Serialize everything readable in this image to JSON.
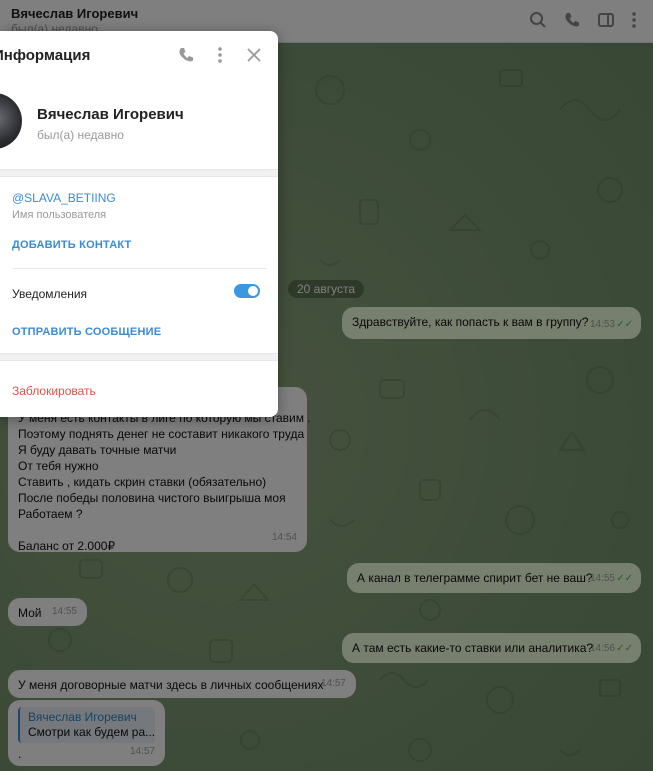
{
  "header": {
    "name": "Вячеслав Игоревич",
    "status": "был(а) недавно",
    "icons": [
      "search-icon",
      "phone-icon",
      "sidebar-icon",
      "more-icon"
    ]
  },
  "panel": {
    "title": "Информация",
    "name": "Вячеслав Игоревич",
    "status": "был(а) недавно",
    "username": "@SLAVA_BETIING",
    "username_label": "Имя пользователя",
    "add_contact": "ДОБАВИТЬ КОНТАКТ",
    "notifications_label": "Уведомления",
    "notifications_on": true,
    "send_message": "ОТПРАВИТЬ СООБЩЕНИЕ",
    "block": "Заблокировать"
  },
  "chat": {
    "date": "20 августа",
    "messages": [
      {
        "text": "Здравствуйте, как попасть к вам в группу?",
        "time": "14:53"
      },
      {
        "lines": [
          "У меня есть контакты в лиге по которую мы ставим .",
          "Поэтому поднять денег не составит никакого труда",
          "Я буду давать точные матчи",
          "От тебя нужно",
          "Ставить , кидать скрин ставки (обязательно)",
          "После победы половина чистого выигрыша моя",
          "Работаем ?",
          "",
          "Баланс от 2.000₽"
        ],
        "time": "14:54"
      },
      {
        "text": "А канал в телеграмме спирит бет не ваш?",
        "time": "14:55"
      },
      {
        "text": "Мой",
        "time": "14:55"
      },
      {
        "text": "А там есть какие-то ставки или аналитика?",
        "time": "14:56"
      },
      {
        "text": "У меня договорные матчи здесь в личных сообщениях",
        "time": "14:57"
      },
      {
        "reply_name": "Вячеслав Игоревич",
        "reply_text": "Смотри как будем ра...",
        "text": ".",
        "time": "14:57"
      }
    ]
  }
}
